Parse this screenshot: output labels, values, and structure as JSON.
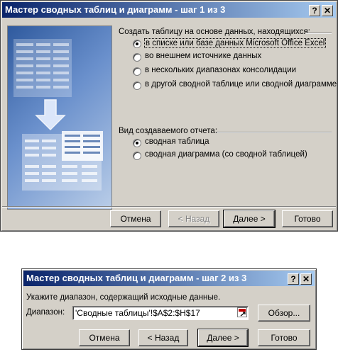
{
  "step1": {
    "title": "Мастер сводных таблиц и диаграмм - шаг 1 из 3",
    "help_glyph": "?",
    "close_glyph": "✕",
    "source_group_label": "Создать таблицу на основе данных, находящихся:",
    "source_options": [
      {
        "label": "в списке или базе данных Microsoft Office Excel",
        "checked": true
      },
      {
        "label": "во внешнем источнике данных",
        "checked": false
      },
      {
        "label": "в нескольких диапазонах консолидации",
        "checked": false
      },
      {
        "label": "в другой сводной таблице или сводной диаграмме",
        "checked": false
      }
    ],
    "report_group_label": "Вид создаваемого отчета:",
    "report_options": [
      {
        "label": "сводная таблица",
        "checked": true
      },
      {
        "label": "сводная диаграмма (со сводной таблицей)",
        "checked": false
      }
    ],
    "buttons": {
      "cancel": "Отмена",
      "back": "< Назад",
      "next": "Далее >",
      "finish": "Готово"
    }
  },
  "step2": {
    "title": "Мастер сводных таблиц и диаграмм - шаг 2 из 3",
    "help_glyph": "?",
    "close_glyph": "✕",
    "instruction": "Укажите диапазон, содержащий исходные данные.",
    "range_label": "Диапазон:",
    "range_value": "'Сводные таблицы'!$A$2:$H$17",
    "buttons": {
      "browse": "Обзор...",
      "cancel": "Отмена",
      "back": "< Назад",
      "next": "Далее >",
      "finish": "Готово"
    }
  },
  "colors": {
    "title_start": "#0a246a",
    "title_end": "#a6caf0",
    "dialog_face": "#d4d0c8"
  }
}
